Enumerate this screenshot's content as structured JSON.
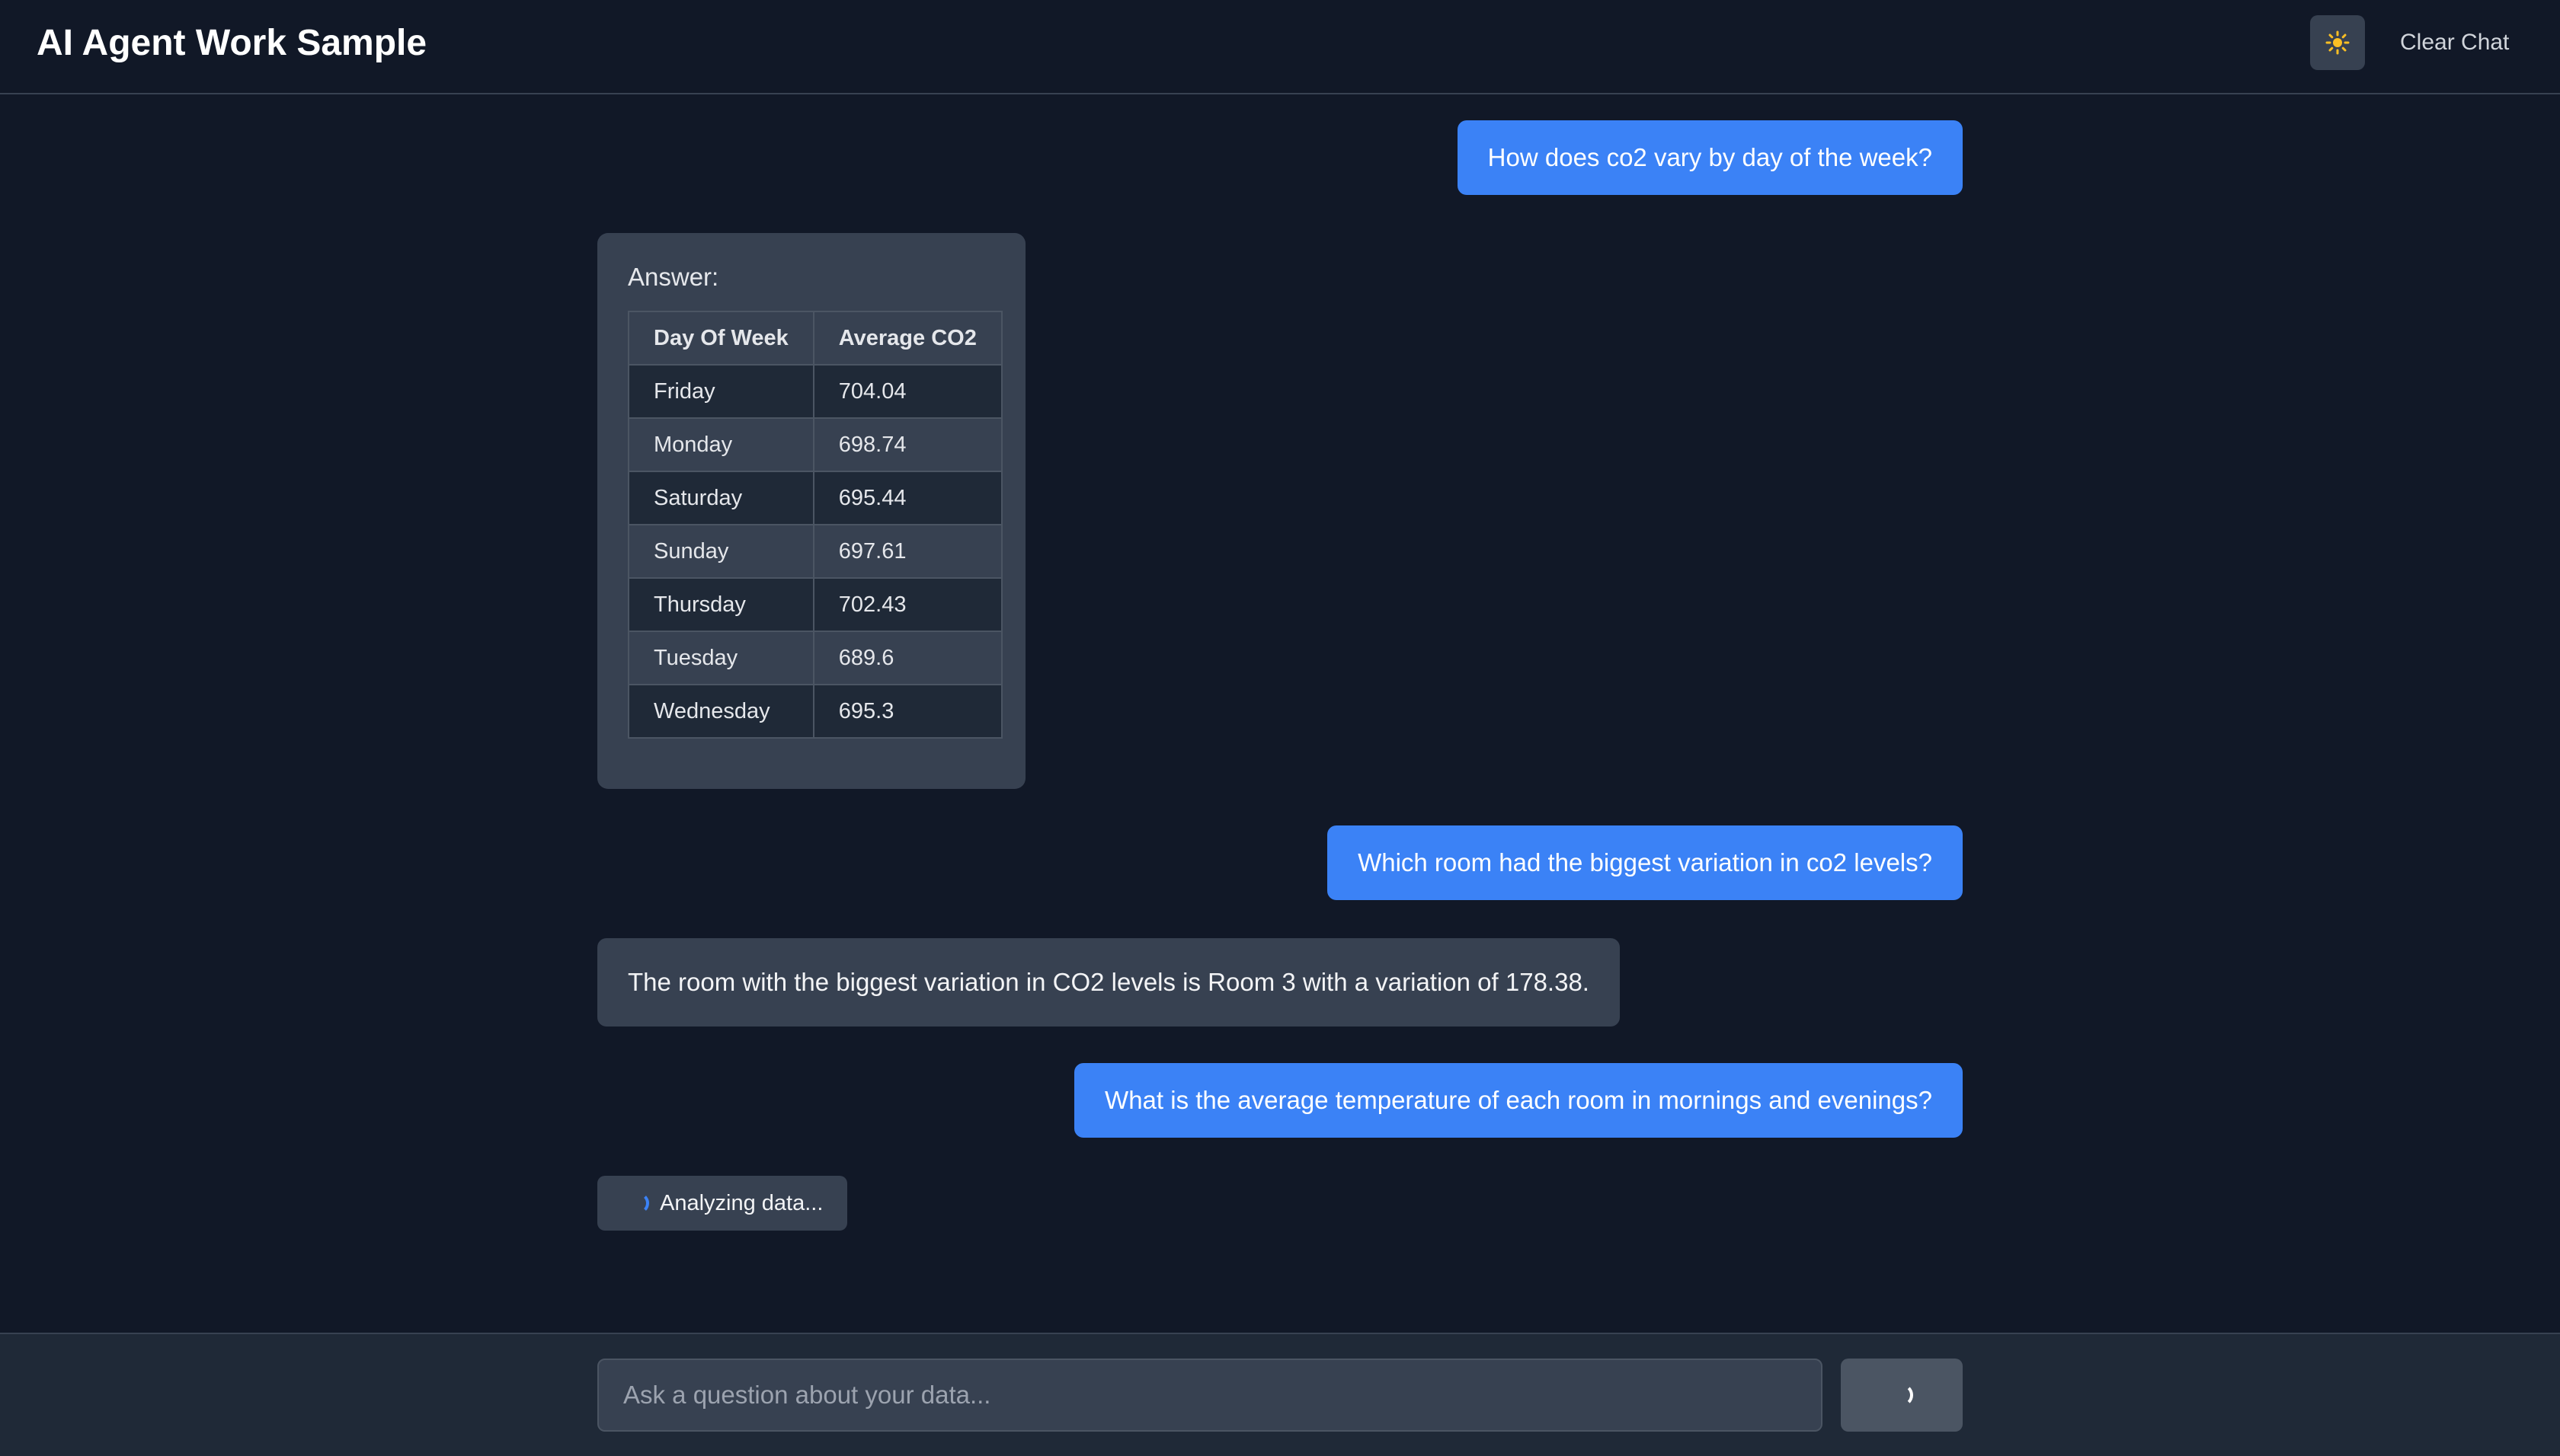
{
  "header": {
    "title": "AI Agent Work Sample",
    "theme_icon": "sun-icon",
    "clear_label": "Clear Chat"
  },
  "messages": {
    "q1": "How does co2 vary by day of the week?",
    "answer_label": "Answer:",
    "table": {
      "columns": [
        "Day Of Week",
        "Average CO2"
      ],
      "rows": [
        [
          "Friday",
          "704.04"
        ],
        [
          "Monday",
          "698.74"
        ],
        [
          "Saturday",
          "695.44"
        ],
        [
          "Sunday",
          "697.61"
        ],
        [
          "Thursday",
          "702.43"
        ],
        [
          "Tuesday",
          "689.6"
        ],
        [
          "Wednesday",
          "695.3"
        ]
      ]
    },
    "q2": "Which room had the biggest variation in co2 levels?",
    "a2": "The room with the biggest variation in CO2 levels is Room 3 with a variation of 178.38.",
    "q3": "What is the average temperature of each room in mornings and evenings?",
    "loading": "Analyzing data..."
  },
  "input": {
    "placeholder": "Ask a question about your data...",
    "value": ""
  },
  "colors": {
    "background": "#111827",
    "user_bubble": "#3b82f6",
    "bot_bubble": "#374151",
    "footer": "#1f2937",
    "sun": "#fbbf24"
  }
}
